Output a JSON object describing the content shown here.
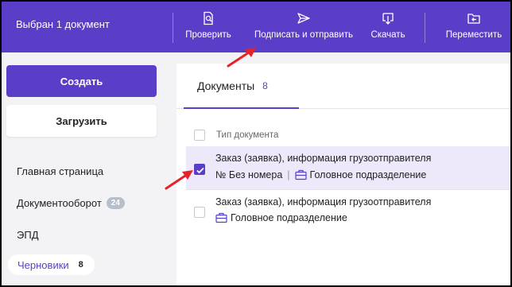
{
  "toolbar": {
    "selected_label": "Выбран 1 документ",
    "buttons": [
      {
        "label": "Проверить",
        "icon": "doc-search-icon"
      },
      {
        "label": "Подписать и отправить",
        "icon": "send-icon"
      },
      {
        "label": "Скачать",
        "icon": "download-icon"
      },
      {
        "label": "Переместить",
        "icon": "move-folder-icon"
      }
    ]
  },
  "sidebar": {
    "create_label": "Создать",
    "upload_label": "Загрузить",
    "items": [
      {
        "label": "Главная страница"
      },
      {
        "label": "Документооборот",
        "badge": "24"
      },
      {
        "label": "ЭПД"
      },
      {
        "label": "Черновики",
        "count": "8"
      }
    ]
  },
  "main": {
    "tab": {
      "label": "Документы",
      "count": "8"
    },
    "column_header": "Тип документа",
    "rows": [
      {
        "title": "Заказ (заявка), информация грузоотправителя",
        "number": "№ Без номера",
        "division": "Головное подразделение",
        "checked": true
      },
      {
        "title": "Заказ (заявка), информация грузоотправителя",
        "division": "Головное подразделение",
        "checked": false
      }
    ]
  },
  "colors": {
    "accent": "#5b3ec8",
    "selected_row": "#ede9fb",
    "arrow": "#e8202a"
  }
}
